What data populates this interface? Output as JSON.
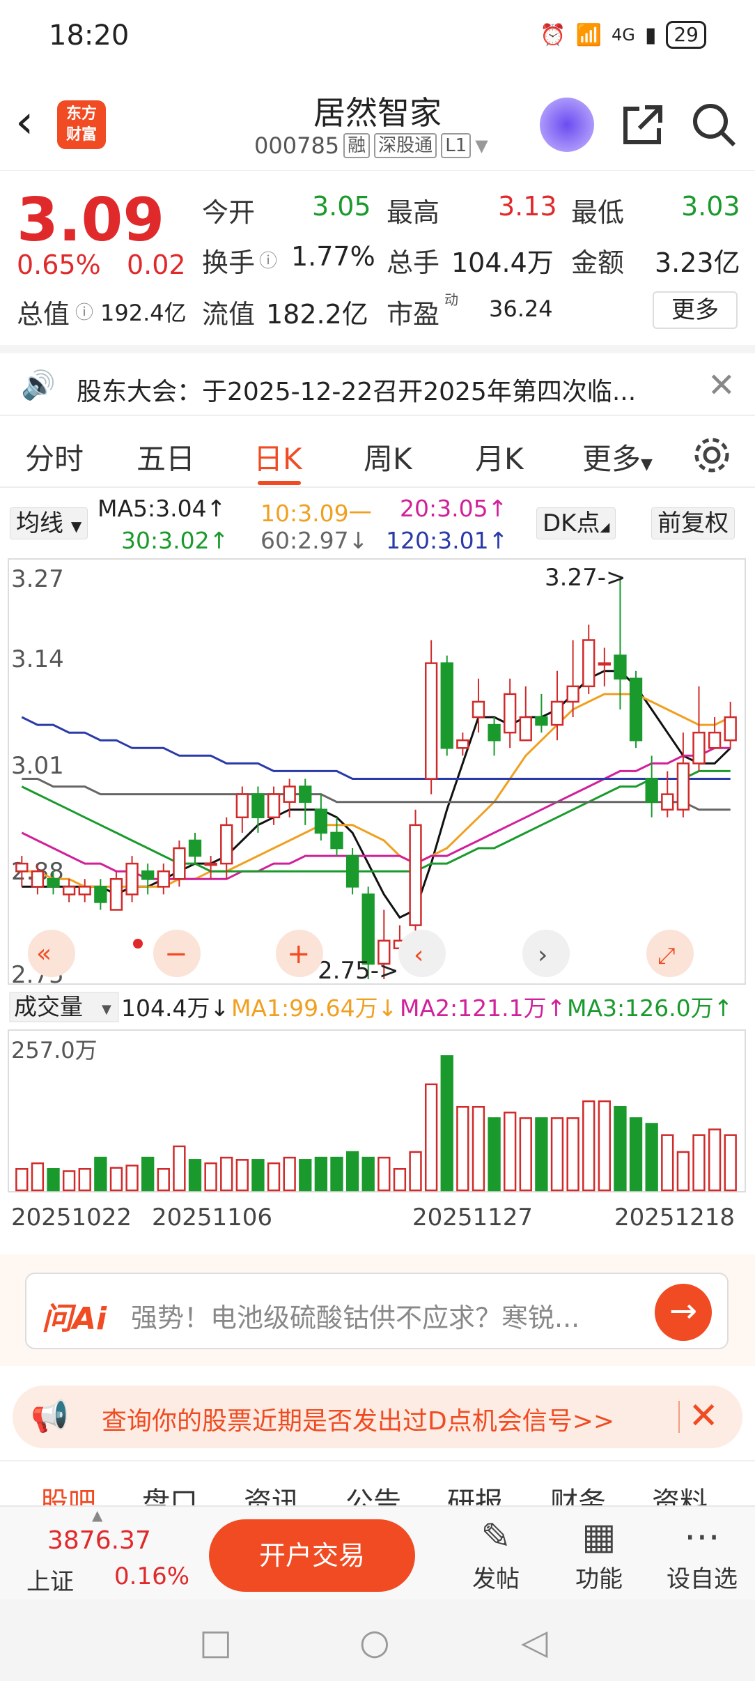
{
  "status": {
    "time": "18:20",
    "net": "4G",
    "battery": "29"
  },
  "header": {
    "name": "居然智家",
    "code": "000785",
    "tag1": "融",
    "tag2": "深股通",
    "tag3": "L1",
    "logo": "东方\n财富"
  },
  "quote": {
    "price": "3.09",
    "pct": "0.65%",
    "chg": "0.02",
    "open_l": "今开",
    "open_v": "3.05",
    "high_l": "最高",
    "high_v": "3.13",
    "low_l": "最低",
    "low_v": "3.03",
    "turn_l": "换手",
    "turn_v": "1.77%",
    "vol_l": "总手",
    "vol_v": "104.4万",
    "amt_l": "金额",
    "amt_v": "3.23亿",
    "cap_l": "总值",
    "cap_v": "192.4亿",
    "flt_l": "流值",
    "flt_v": "182.2亿",
    "pe_l": "市盈",
    "pe_sup": "动",
    "pe_v": "36.24",
    "more": "更多"
  },
  "notice": {
    "text": "股东大会：于2025-12-22召开2025年第四次临..."
  },
  "period_tabs": [
    "分时",
    "五日",
    "日K",
    "周K",
    "月K",
    "更多"
  ],
  "ma": {
    "dropdown": "均线",
    "ma5": "MA5:3.04↑",
    "ma10": "10:3.09一",
    "ma20": "20:3.05↑",
    "ma30": "30:3.02↑",
    "ma60": "60:2.97↓",
    "ma120": "120:3.01↑",
    "dk": "DK点",
    "fq": "前复权"
  },
  "chart_data": {
    "type": "candlestick",
    "y_ticks": [
      "3.27",
      "3.14",
      "3.01",
      "2.88",
      "2.75"
    ],
    "ylim": [
      2.75,
      3.27
    ],
    "high_label": "3.27->",
    "low_label": "2.75->",
    "x_ticks": [
      "20251022",
      "20251106",
      "20251127",
      "20251218"
    ],
    "candles": [
      [
        2.89,
        2.9,
        2.87,
        2.91
      ],
      [
        2.87,
        2.89,
        2.86,
        2.9
      ],
      [
        2.88,
        2.87,
        2.86,
        2.89
      ],
      [
        2.86,
        2.87,
        2.85,
        2.88
      ],
      [
        2.86,
        2.87,
        2.85,
        2.88
      ],
      [
        2.87,
        2.85,
        2.84,
        2.88
      ],
      [
        2.84,
        2.88,
        2.84,
        2.89
      ],
      [
        2.86,
        2.9,
        2.85,
        2.91
      ],
      [
        2.89,
        2.88,
        2.86,
        2.9
      ],
      [
        2.87,
        2.89,
        2.86,
        2.9
      ],
      [
        2.88,
        2.92,
        2.87,
        2.93
      ],
      [
        2.93,
        2.91,
        2.9,
        2.94
      ],
      [
        2.9,
        2.9,
        2.88,
        2.91
      ],
      [
        2.9,
        2.95,
        2.88,
        2.96
      ],
      [
        2.96,
        2.99,
        2.94,
        3.0
      ],
      [
        2.99,
        2.96,
        2.94,
        3.0
      ],
      [
        2.96,
        2.99,
        2.95,
        3.0
      ],
      [
        2.98,
        3.0,
        2.96,
        3.01
      ],
      [
        3.0,
        2.98,
        2.95,
        3.01
      ],
      [
        2.97,
        2.94,
        2.93,
        2.99
      ],
      [
        2.94,
        2.92,
        2.91,
        2.96
      ],
      [
        2.91,
        2.87,
        2.86,
        2.92
      ],
      [
        2.86,
        2.77,
        2.75,
        2.87
      ],
      [
        2.77,
        2.8,
        2.75,
        2.84
      ],
      [
        2.79,
        2.8,
        2.78,
        2.82
      ],
      [
        2.82,
        2.95,
        2.81,
        2.97
      ],
      [
        3.01,
        3.16,
        2.99,
        3.19
      ],
      [
        3.16,
        3.05,
        3.04,
        3.17
      ],
      [
        3.05,
        3.06,
        3.04,
        3.07
      ],
      [
        3.09,
        3.11,
        3.07,
        3.14
      ],
      [
        3.08,
        3.06,
        3.04,
        3.09
      ],
      [
        3.07,
        3.12,
        3.05,
        3.14
      ],
      [
        3.06,
        3.09,
        3.06,
        3.13
      ],
      [
        3.09,
        3.08,
        3.07,
        3.12
      ],
      [
        3.08,
        3.11,
        3.06,
        3.15
      ],
      [
        3.11,
        3.13,
        3.09,
        3.19
      ],
      [
        3.13,
        3.19,
        3.12,
        3.21
      ],
      [
        3.16,
        3.16,
        3.13,
        3.18
      ],
      [
        3.17,
        3.14,
        3.1,
        3.27
      ],
      [
        3.14,
        3.06,
        3.05,
        3.15
      ],
      [
        3.01,
        2.98,
        2.96,
        3.04
      ],
      [
        2.97,
        2.99,
        2.96,
        3.02
      ],
      [
        2.97,
        3.03,
        2.96,
        3.07
      ],
      [
        3.03,
        3.07,
        3.02,
        3.13
      ],
      [
        3.05,
        3.07,
        3.05,
        3.09
      ],
      [
        3.06,
        3.09,
        3.05,
        3.11
      ]
    ],
    "ma_lines": {
      "ma5_black": [
        2.87,
        2.87,
        2.87,
        2.87,
        2.87,
        2.87,
        2.86,
        2.87,
        2.87,
        2.88,
        2.89,
        2.9,
        2.9,
        2.91,
        2.93,
        2.95,
        2.96,
        2.97,
        2.97,
        2.97,
        2.96,
        2.94,
        2.9,
        2.86,
        2.83,
        2.84,
        2.9,
        2.97,
        3.03,
        3.09,
        3.09,
        3.08,
        3.09,
        3.09,
        3.1,
        3.12,
        3.14,
        3.15,
        3.15,
        3.13,
        3.1,
        3.07,
        3.04,
        3.03,
        3.03,
        3.05
      ],
      "ma10_orange": [
        2.89,
        2.89,
        2.88,
        2.88,
        2.87,
        2.87,
        2.87,
        2.87,
        2.87,
        2.87,
        2.88,
        2.88,
        2.89,
        2.89,
        2.9,
        2.91,
        2.92,
        2.93,
        2.94,
        2.95,
        2.95,
        2.95,
        2.94,
        2.93,
        2.91,
        2.9,
        2.91,
        2.92,
        2.94,
        2.96,
        2.98,
        3.01,
        3.04,
        3.06,
        3.08,
        3.1,
        3.11,
        3.12,
        3.12,
        3.12,
        3.11,
        3.1,
        3.09,
        3.08,
        3.08,
        3.09
      ],
      "ma20_magenta": [
        2.94,
        2.93,
        2.92,
        2.91,
        2.9,
        2.9,
        2.89,
        2.89,
        2.88,
        2.88,
        2.88,
        2.88,
        2.88,
        2.88,
        2.89,
        2.89,
        2.9,
        2.9,
        2.91,
        2.91,
        2.91,
        2.91,
        2.91,
        2.91,
        2.91,
        2.9,
        2.91,
        2.91,
        2.92,
        2.93,
        2.94,
        2.95,
        2.96,
        2.97,
        2.98,
        2.99,
        3.0,
        3.01,
        3.02,
        3.02,
        3.03,
        3.03,
        3.04,
        3.04,
        3.05,
        3.05
      ],
      "ma30_green": [
        3.0,
        2.99,
        2.98,
        2.97,
        2.96,
        2.95,
        2.94,
        2.93,
        2.92,
        2.91,
        2.9,
        2.9,
        2.89,
        2.89,
        2.89,
        2.89,
        2.89,
        2.89,
        2.89,
        2.89,
        2.89,
        2.89,
        2.89,
        2.89,
        2.89,
        2.89,
        2.9,
        2.9,
        2.91,
        2.92,
        2.92,
        2.93,
        2.94,
        2.95,
        2.96,
        2.97,
        2.98,
        2.99,
        3.0,
        3.0,
        3.01,
        3.01,
        3.01,
        3.02,
        3.02,
        3.02
      ],
      "ma60_gray": [
        3.01,
        3.01,
        3.0,
        3.0,
        3.0,
        2.99,
        2.99,
        2.99,
        2.99,
        2.99,
        2.99,
        2.99,
        2.99,
        2.99,
        2.99,
        2.99,
        2.99,
        2.99,
        2.99,
        2.99,
        2.98,
        2.98,
        2.98,
        2.98,
        2.98,
        2.98,
        2.98,
        2.98,
        2.98,
        2.98,
        2.98,
        2.98,
        2.98,
        2.98,
        2.98,
        2.98,
        2.98,
        2.98,
        2.98,
        2.98,
        2.98,
        2.98,
        2.98,
        2.97,
        2.97,
        2.97
      ],
      "ma120_blue": [
        3.09,
        3.08,
        3.08,
        3.07,
        3.07,
        3.06,
        3.06,
        3.05,
        3.05,
        3.05,
        3.04,
        3.04,
        3.04,
        3.03,
        3.03,
        3.03,
        3.02,
        3.02,
        3.02,
        3.02,
        3.02,
        3.01,
        3.01,
        3.01,
        3.01,
        3.01,
        3.01,
        3.01,
        3.01,
        3.01,
        3.01,
        3.01,
        3.01,
        3.01,
        3.01,
        3.01,
        3.01,
        3.01,
        3.01,
        3.01,
        3.01,
        3.01,
        3.01,
        3.01,
        3.01,
        3.01
      ]
    },
    "volume_label": "成交量",
    "volume_info": {
      "v": "104.4万↓",
      "ma1": "MA1:99.64万↓",
      "ma2": "MA2:121.1万↑",
      "ma3": "MA3:126.0万↑"
    },
    "volume_max_label": "257.0万",
    "volume": [
      38,
      48,
      38,
      34,
      38,
      58,
      40,
      44,
      58,
      38,
      78,
      54,
      48,
      58,
      54,
      54,
      48,
      58,
      54,
      58,
      58,
      68,
      58,
      58,
      38,
      68,
      188,
      238,
      148,
      148,
      128,
      138,
      128,
      128,
      128,
      128,
      158,
      158,
      148,
      128,
      118,
      98,
      68,
      98,
      108,
      98
    ]
  },
  "ai": {
    "logo": "问Ai",
    "text": "强势！电池级硫酸钴供不应求？寒锐..."
  },
  "promo": {
    "text": "查询你的股票近期是否发出过D点机会信号>>"
  },
  "section_tabs": [
    "股吧",
    "盘口",
    "资讯",
    "公告",
    "研报",
    "财务",
    "资料"
  ],
  "toolbar": {
    "idx_val": "3876.37",
    "idx_name": "上证",
    "idx_pct": "0.16%",
    "trade": "开户交易",
    "post": "发帖",
    "func": "功能",
    "custom": "设自选"
  }
}
